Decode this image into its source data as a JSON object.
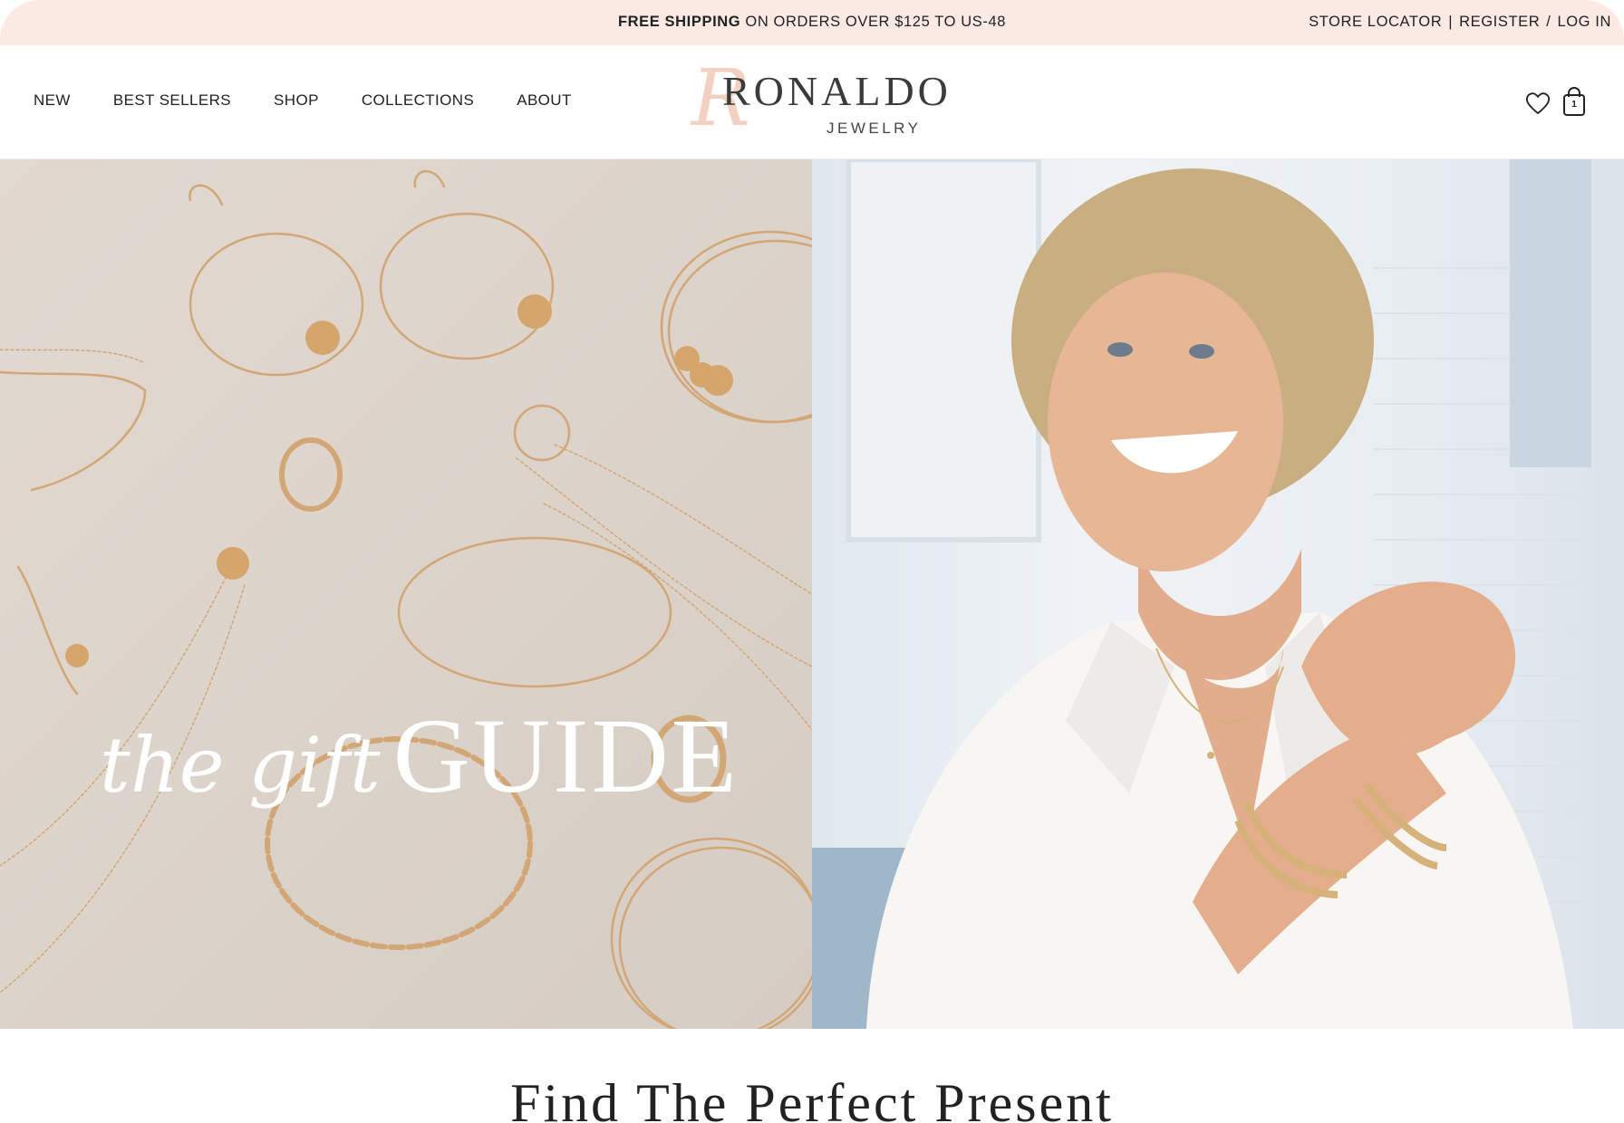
{
  "announcement": {
    "bold": "FREE SHIPPING",
    "text": " ON ORDERS OVER $125 TO US-48",
    "store_locator": "STORE LOCATOR",
    "sep1": "|",
    "register": "REGISTER",
    "sep2": "/",
    "login": "LOG IN"
  },
  "nav": {
    "items": [
      "NEW",
      "BEST SELLERS",
      "SHOP",
      "COLLECTIONS",
      "ABOUT"
    ]
  },
  "logo": {
    "initial": "R",
    "name": "RONALDO",
    "sub": "JEWELRY"
  },
  "cart": {
    "count": "1"
  },
  "icons": {
    "wishlist": "heart-icon",
    "cart": "shopping-bag-icon"
  },
  "hero": {
    "script": "the gift",
    "caps": "GUIDE"
  },
  "section": {
    "heading": "Find The Perfect Present"
  },
  "colors": {
    "announcement_bg": "#fbe9e3",
    "logo_accent": "#f4d0c2",
    "text": "#222222"
  }
}
